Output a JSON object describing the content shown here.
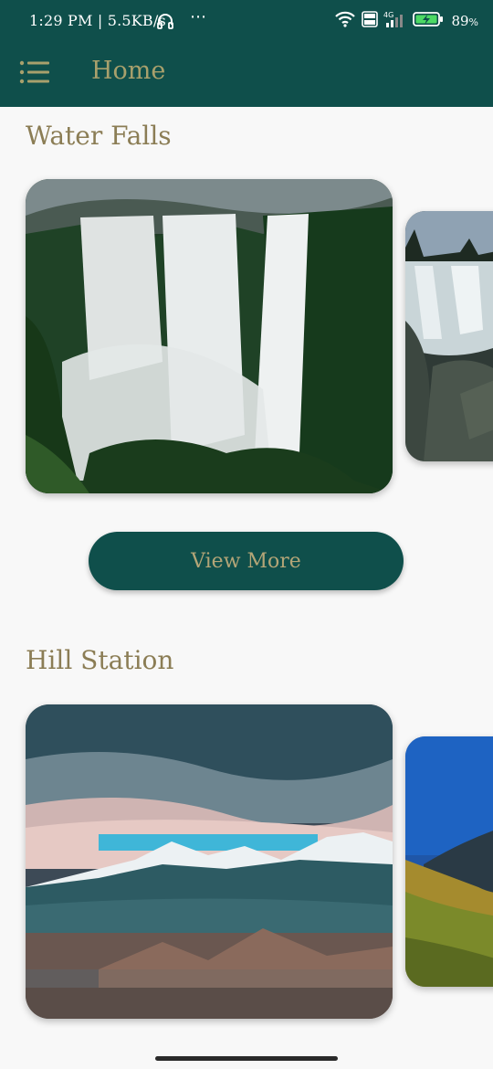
{
  "status_bar": {
    "time": "1:29 PM | 5.5KB/s",
    "overflow": "⋯",
    "battery": "89",
    "battery_unit": "%",
    "network_label": "4G"
  },
  "app_bar": {
    "title": "Home",
    "menu_icon": "list-menu-icon"
  },
  "sections": [
    {
      "title": "Water Falls",
      "cards": [
        "waterfall-photo",
        "waterfall-rocks-photo"
      ]
    },
    {
      "title": "Hill Station",
      "cards": [
        "snow-mountain-photo",
        "green-hill-photo"
      ]
    }
  ],
  "view_more_label": "View More",
  "colors": {
    "primary": "#0f4f4b",
    "title_gold": "#a8a06c",
    "section_title": "#8b7d55",
    "background": "#f8f8f8"
  }
}
